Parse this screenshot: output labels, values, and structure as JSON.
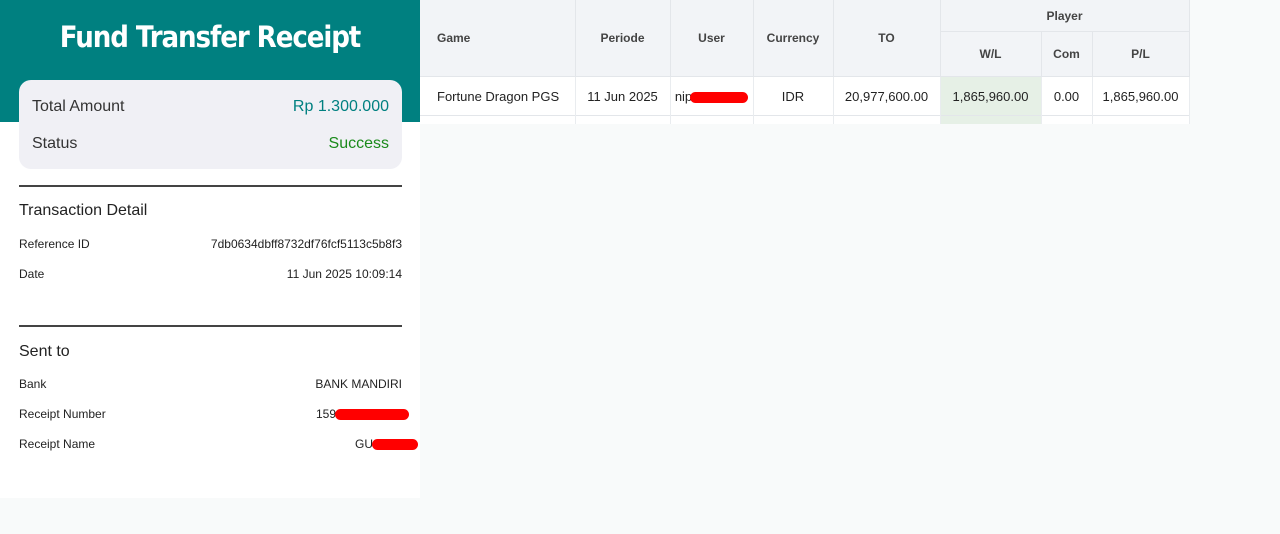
{
  "receipt": {
    "title": "Fund Transfer Receipt",
    "summary": {
      "total_amount_label": "Total Amount",
      "total_amount_value": "Rp 1.300.000",
      "status_label": "Status",
      "status_value": "Success"
    },
    "transaction_detail": {
      "title": "Transaction Detail",
      "reference_id_label": "Reference ID",
      "reference_id_value": "7db0634dbff8732df76fcf5113c5b8f3",
      "date_label": "Date",
      "date_value": "11 Jun 2025 10:09:14"
    },
    "sent_to": {
      "title": "Sent to",
      "bank_label": "Bank",
      "bank_value": "BANK MANDIRI",
      "receipt_number_label": "Receipt Number",
      "receipt_number_value": "159",
      "receipt_name_label": "Receipt Name",
      "receipt_name_value": "GU"
    },
    "colors": {
      "header": "#008080",
      "amount": "#008080",
      "success": "#1a8a1a",
      "redaction": "#ff0000"
    }
  },
  "report_table": {
    "headers": {
      "game": "Game",
      "periode": "Periode",
      "user": "User",
      "currency": "Currency",
      "to": "TO",
      "player": "Player",
      "wl": "W/L",
      "com": "Com",
      "pl": "P/L"
    },
    "rows": [
      {
        "game": "Fortune Dragon PGS",
        "periode": "11 Jun 2025",
        "user": "nip",
        "currency": "IDR",
        "to": "20,977,600.00",
        "wl": "1,865,960.00",
        "com": "0.00",
        "pl": "1,865,960.00"
      }
    ]
  }
}
